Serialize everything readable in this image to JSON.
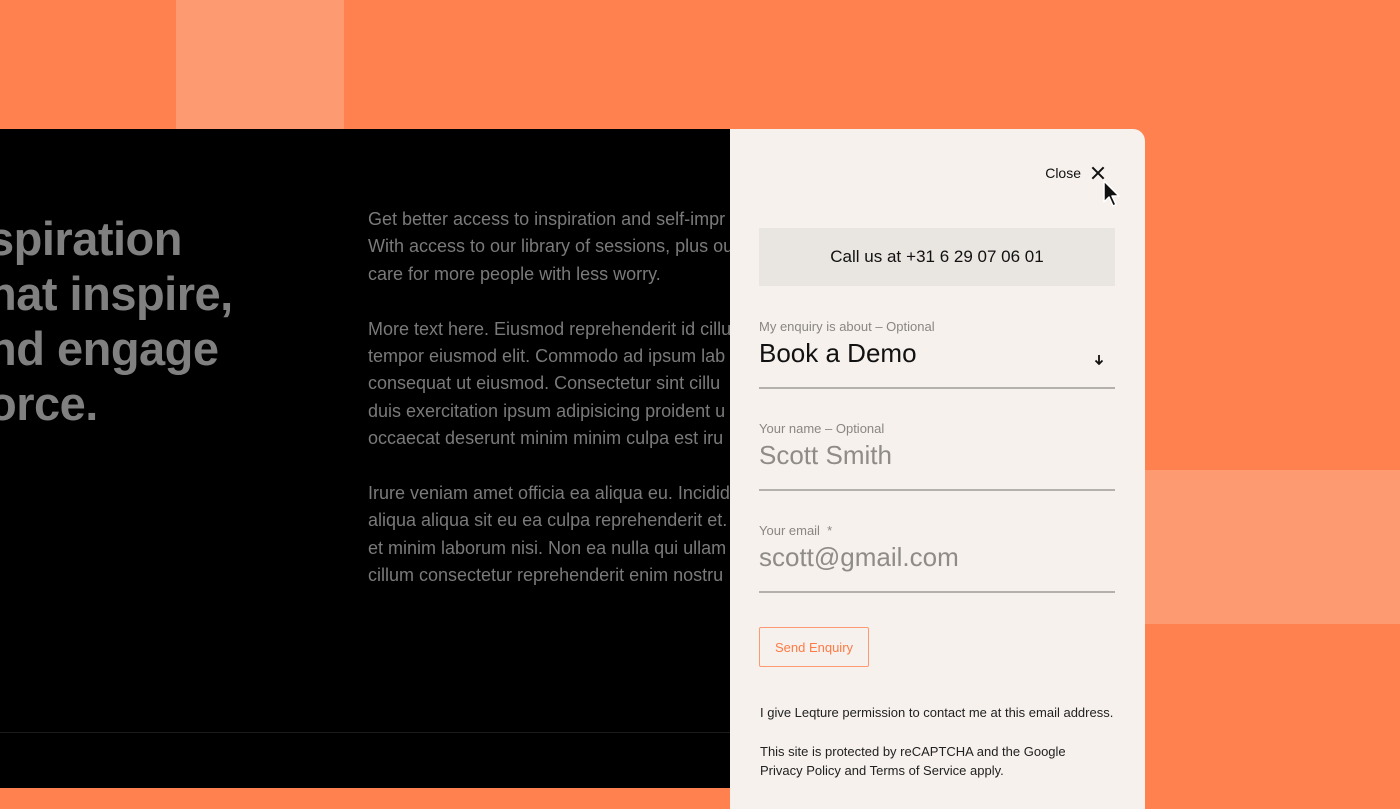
{
  "colors": {
    "background": "#ff8150",
    "background_light": "#fd9a72",
    "dark_panel": "#000000",
    "modal_bg": "#f6f1ed",
    "accent": "#ff7a45"
  },
  "hero": {
    "title_lines": [
      "spiration",
      "hat inspire,",
      "nd engage",
      "orce."
    ]
  },
  "body_copy": {
    "paragraphs": [
      [
        "Get better access to inspiration and self-impr",
        "With access to our library of sessions, plus ou",
        "care for more people with less worry."
      ],
      [
        "More text here. Eiusmod reprehenderit id cillu",
        "tempor eiusmod elit. Commodo ad ipsum lab",
        "consequat ut eiusmod. Consectetur sint cillu",
        "duis exercitation ipsum adipisicing proident u",
        "occaecat deserunt minim minim culpa est iru"
      ],
      [
        "Irure veniam amet officia ea aliqua eu. Incidid",
        "aliqua aliqua sit eu ea culpa reprehenderit et.",
        "et minim laborum nisi. Non ea nulla qui ullam",
        "cillum consectetur reprehenderit enim nostru"
      ]
    ]
  },
  "modal": {
    "close_label": "Close",
    "call_prefix": "Call us at",
    "phone": "+31 6 29 07 06 01",
    "enquiry": {
      "label": "My enquiry is about – Optional",
      "value": "Book a Demo"
    },
    "name": {
      "label": "Your name – Optional",
      "value": "Scott Smith"
    },
    "email": {
      "label": "Your email  *",
      "value": "scott@gmail.com"
    },
    "submit_label": "Send Enquiry",
    "permission_text": "I give Leqture permission to contact me at this email address.",
    "recaptcha_text": "This site is protected by reCAPTCHA and the Google Privacy Policy and Terms of Service apply."
  }
}
